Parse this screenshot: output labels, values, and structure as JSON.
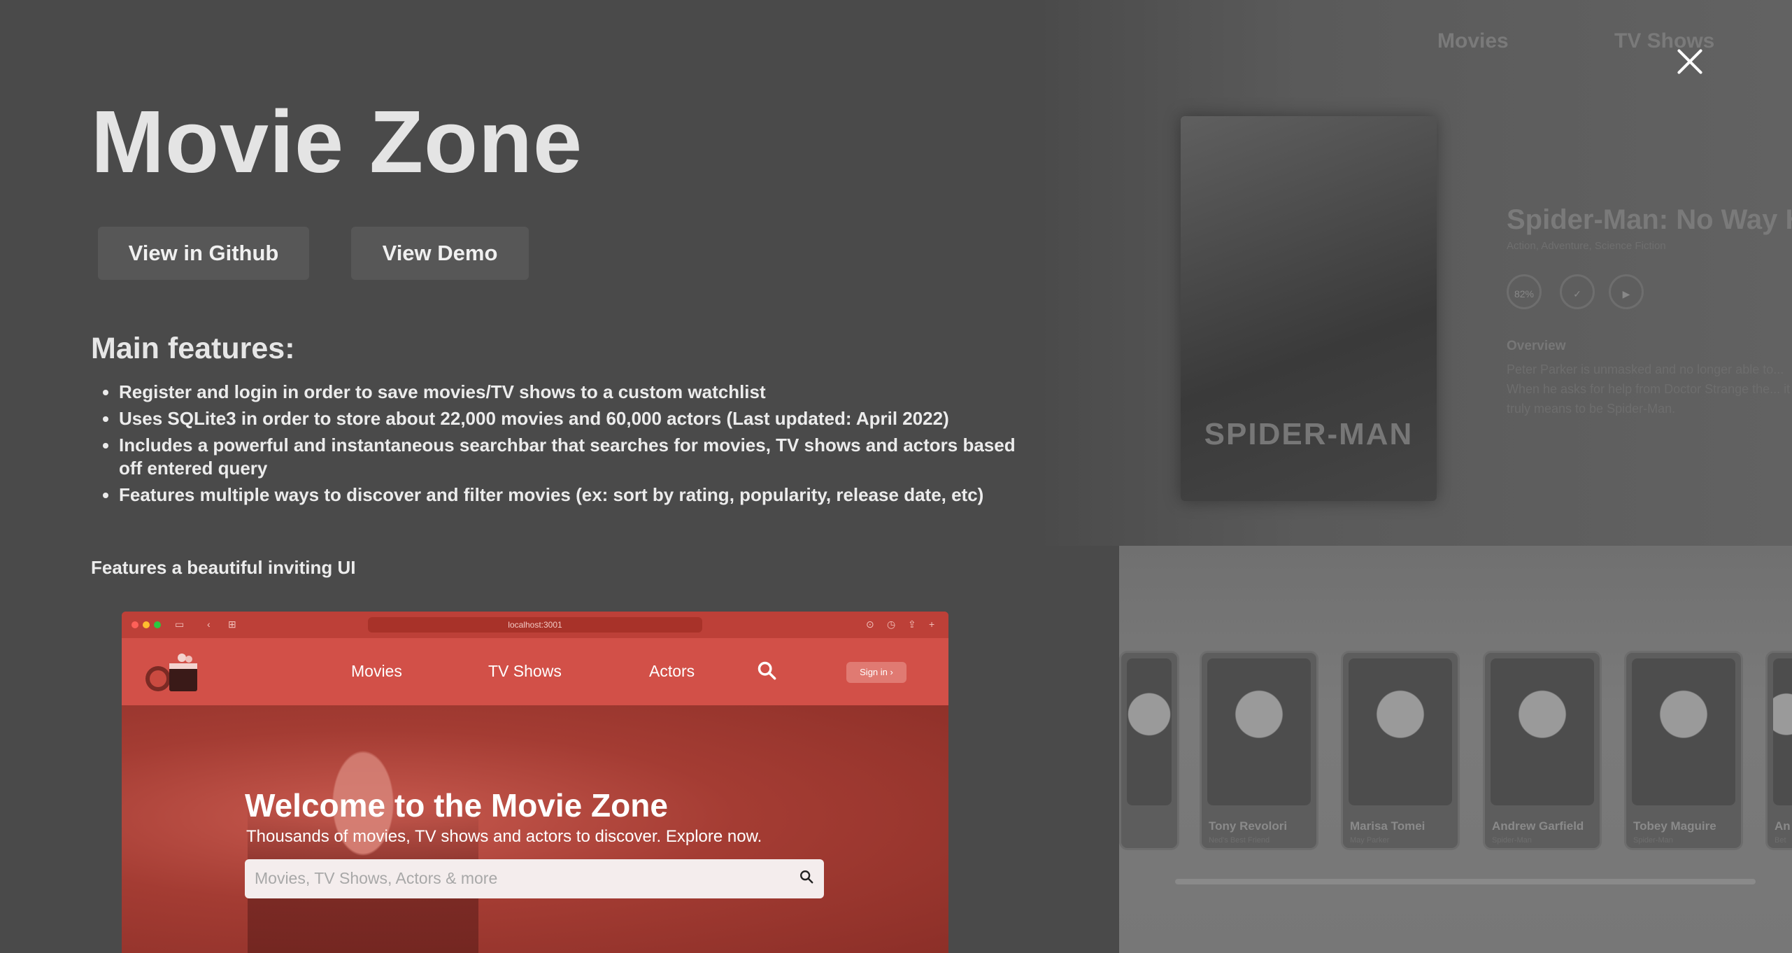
{
  "background": {
    "nav": {
      "movies": "Movies",
      "tv_shows": "TV Shows"
    },
    "movie": {
      "poster_text": "SPIDER-MAN",
      "poster_subtitle": "No Way Home",
      "title": "Spider-Man: No Way H",
      "genres": "Action, Adventure, Science Fiction",
      "rating": "82%",
      "overview_heading": "Overview",
      "overview": "Peter Parker is unmasked and no longer able to... When he asks for help from Doctor Strange the... it truly means to be Spider-Man."
    },
    "cast": [
      {
        "name": "Tony Revolori",
        "role": "Ned's Best Friend"
      },
      {
        "name": "Marisa Tomei",
        "role": "May Parker"
      },
      {
        "name": "Andrew Garfield",
        "role": "Spider-Man"
      },
      {
        "name": "Tobey Maguire",
        "role": "Spider-Man"
      },
      {
        "name": "An",
        "role": "Bet"
      }
    ]
  },
  "modal": {
    "close_icon": "close-icon",
    "title": "Movie Zone",
    "github_button": "View in Github",
    "demo_button": "View Demo",
    "features_heading": "Main features:",
    "features": [
      "Register and login in order to save movies/TV shows to a custom watchlist",
      "Uses SQLite3 in order to store about 22,000 movies and 60,000 actors (Last updated: April 2022)",
      "Includes a powerful and instantaneous searchbar that searches for movies, TV shows and actors based off entered query",
      "Features multiple ways to discover and filter movies (ex: sort by rating, popularity, release date, etc)"
    ],
    "ui_heading": "Features a beautiful inviting UI"
  },
  "screenshot": {
    "url": "localhost:3001",
    "nav": {
      "movies": "Movies",
      "tv_shows": "TV Shows",
      "actors": "Actors",
      "sign_in": "Sign in ›"
    },
    "hero_title": "Welcome to the Movie Zone",
    "hero_subtitle": "Thousands of movies, TV shows and actors to discover. Explore now.",
    "search_placeholder": "Movies, TV Shows, Actors & more"
  },
  "colors": {
    "overlay": "#4a4a4a",
    "screenshot_accent": "#d25048"
  }
}
